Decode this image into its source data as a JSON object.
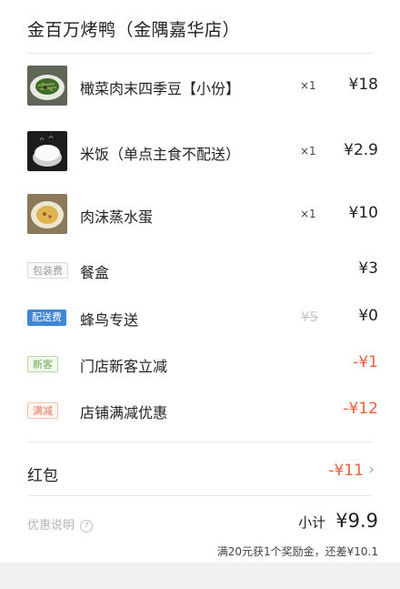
{
  "shop": {
    "name": "金百万烤鸭（金隅嘉华店）"
  },
  "items": [
    {
      "name": "橄菜肉末四季豆【小份】",
      "qty": "×1",
      "price": "¥18",
      "image": "stir-fried-green-beans"
    },
    {
      "name": "米饭（单点主食不配送）",
      "qty": "×1",
      "price": "¥2.9",
      "image": "steamed-rice-bowl"
    },
    {
      "name": "肉沫蒸水蛋",
      "qty": "×1",
      "price": "¥10",
      "image": "steamed-egg-custard"
    }
  ],
  "fees": {
    "packaging": {
      "tag": "包装费",
      "label": "餐盒",
      "amount": "¥3"
    },
    "delivery": {
      "tag": "配送费",
      "label": "蜂鸟专送",
      "original": "¥5",
      "amount": "¥0"
    },
    "new_customer": {
      "tag": "新客",
      "label": "门店新客立减",
      "amount": "-¥1"
    },
    "full_reduction": {
      "tag": "满减",
      "label": "店铺满减优惠",
      "amount": "-¥12"
    }
  },
  "red_packet": {
    "label": "红包",
    "amount": "-¥11",
    "icon": "chevron-right-icon"
  },
  "summary": {
    "discount_note": "优惠说明",
    "help_icon": "question-circle-icon",
    "subtotal_label": "小计",
    "subtotal_value": "¥9.9",
    "reward_line": "满20元获1个奖励金，还差¥10.1"
  },
  "colors": {
    "accent_red": "#e8603c",
    "delivery_tag": "#3f86d8",
    "new_tag": "#6aa84f"
  }
}
